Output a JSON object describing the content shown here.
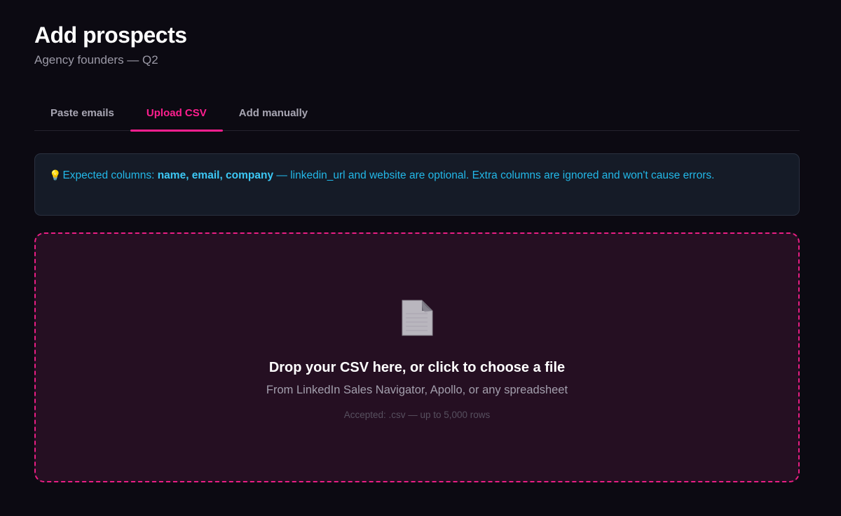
{
  "header": {
    "title": "Add prospects",
    "subtitle": "Agency founders — Q2"
  },
  "tabs": [
    {
      "label": "Paste emails",
      "active": false
    },
    {
      "label": "Upload CSV",
      "active": true
    },
    {
      "label": "Add manually",
      "active": false
    }
  ],
  "info": {
    "icon": "lightbulb-icon",
    "prefix": "Expected columns: ",
    "required_columns": "name, email, company",
    "suffix": " — linkedin_url and website are optional. Extra columns are ignored and won't cause errors."
  },
  "dropzone": {
    "icon": "file-icon",
    "title": "Drop your CSV here, or click to choose a file",
    "subtitle": "From LinkedIn Sales Navigator, Apollo, or any spreadsheet",
    "note": "Accepted: .csv — up to 5,000 rows"
  },
  "colors": {
    "accent": "#ff1f8f",
    "info_text": "#22b8e8",
    "background": "#0c0a12"
  }
}
